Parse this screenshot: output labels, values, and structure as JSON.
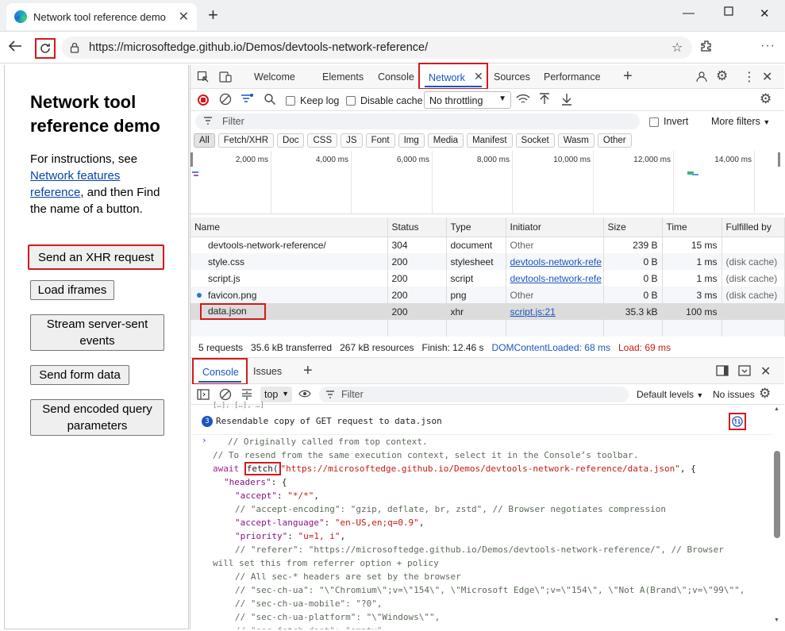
{
  "browser": {
    "tab_title": "Network tool reference demo",
    "url": "https://microsoftedge.github.io/Demos/devtools-network-reference/"
  },
  "page": {
    "heading": "Network tool reference demo",
    "intro_before": "For instructions, see",
    "intro_link": "Network features reference",
    "intro_after": ", and then Find the name of a button.",
    "buttons": [
      "Send an XHR request",
      "Load iframes",
      "Stream server-sent events",
      "Send form data",
      "Send encoded query parameters"
    ]
  },
  "devtools": {
    "tabs": [
      "Welcome",
      "Elements",
      "Console",
      "Network",
      "Sources",
      "Performance"
    ],
    "network_toolbar": {
      "preserve_log": "Keep log",
      "disable_cache": "Disable cache",
      "throttling": "No throttling"
    },
    "filter": {
      "placeholder": "Filter",
      "invert": "Invert",
      "more_filters": "More filters"
    },
    "type_filters": [
      "All",
      "Fetch/XHR",
      "Doc",
      "CSS",
      "JS",
      "Font",
      "Img",
      "Media",
      "Manifest",
      "Socket",
      "Wasm",
      "Other"
    ],
    "timeline_ticks": [
      "2,000 ms",
      "4,000 ms",
      "6,000 ms",
      "8,000 ms",
      "10,000 ms",
      "12,000 ms",
      "14,000 ms"
    ],
    "columns": [
      "Name",
      "Status",
      "Type",
      "Initiator",
      "Size",
      "Time",
      "Fulfilled by"
    ],
    "rows": [
      {
        "name": "devtools-network-reference/",
        "status": "304",
        "type": "document",
        "initiator": "Other",
        "size": "239 B",
        "time": "15 ms",
        "fulfilled": ""
      },
      {
        "name": "style.css",
        "status": "200",
        "type": "stylesheet",
        "initiator": "devtools-network-refe",
        "size": "0 B",
        "time": "1 ms",
        "fulfilled": "(disk cache)"
      },
      {
        "name": "script.js",
        "status": "200",
        "type": "script",
        "initiator": "devtools-network-refe",
        "size": "0 B",
        "time": "1 ms",
        "fulfilled": "(disk cache)"
      },
      {
        "name": "favicon.png",
        "status": "200",
        "type": "png",
        "initiator": "Other",
        "size": "0 B",
        "time": "3 ms",
        "fulfilled": "(disk cache)"
      },
      {
        "name": "data.json",
        "status": "200",
        "type": "xhr",
        "initiator": "script.js:21",
        "size": "35.3 kB",
        "time": "100 ms",
        "fulfilled": ""
      }
    ],
    "summary": {
      "requests": "5 requests",
      "transferred": "35.6 kB transferred",
      "resources": "267 kB resources",
      "finish": "Finish: 12.46 s",
      "dcl": "DOMContentLoaded: 68 ms",
      "load": "Load: 69 ms"
    },
    "drawer_tabs": [
      "Console",
      "Issues"
    ],
    "console_toolbar": {
      "context": "top",
      "filter_placeholder": "Filter",
      "levels": "Default levels",
      "issues": "No issues"
    },
    "console": {
      "group_count": "3",
      "message": "Resendable copy of GET request to data.json",
      "code": {
        "c1": "// Originally called from top context.",
        "c2": "// To resend from the same execution context, select it in the Console’s toolbar.",
        "await": "await",
        "fetch": "fetch(",
        "fetch_url": "\"https://microsoftedge.github.io/Demos/devtools-network-reference/data.json\"",
        "fetch_tail": ", {",
        "headers": "\"headers\"",
        "accept_k": "\"accept\"",
        "accept_v": "\"*/*\"",
        "enc_comment": "// \"accept-encoding\": \"gzip, deflate, br, zstd\", // Browser negotiates compression",
        "lang_k": "\"accept-language\"",
        "lang_v": "\"en-US,en;q=0.9\"",
        "prio_k": "\"priority\"",
        "prio_v": "\"u=1, i\"",
        "ref_comment": "// \"referer\": \"https://microsoftedge.github.io/Demos/devtools-network-reference/\", // Browser",
        "ref_comment2": "will set this from referrer option + policy",
        "sec_comment": "// All sec-* headers are set by the browser",
        "ua_comment": "// \"sec-ch-ua\": \"\\\"Chromium\\\";v=\\\"154\\\", \\\"Microsoft Edge\\\";v=\\\"154\\\", \\\"Not A(Brand\\\";v=\\\"99\\\"\",",
        "mobile_comment": "// \"sec-ch-ua-mobile\": \"?0\",",
        "platform_comment": "// \"sec-ch-ua-platform\": \"\\\"Windows\\\"\","
      }
    }
  }
}
